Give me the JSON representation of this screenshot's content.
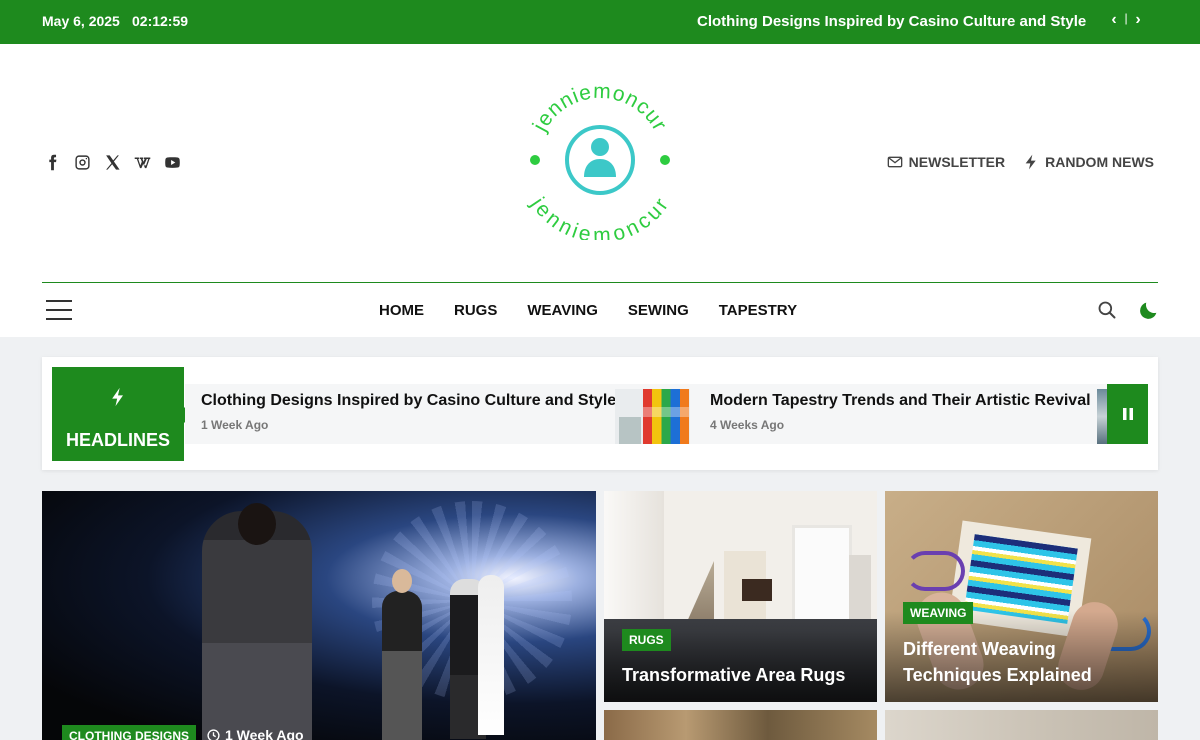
{
  "topbar": {
    "date": "May 6, 2025",
    "time": "02:12:59",
    "ticker": "Clothing Designs Inspired by Casino Culture and Style",
    "prev": "‹",
    "next": "›",
    "sep": "|"
  },
  "header": {
    "logo_text": "jenniemoncur",
    "social": [
      "facebook-icon",
      "instagram-icon",
      "x-icon",
      "wikipedia-icon",
      "youtube-icon"
    ],
    "newsletter": "NEWSLETTER",
    "random_news": "RANDOM NEWS"
  },
  "nav": {
    "items": [
      "HOME",
      "RUGS",
      "WEAVING",
      "SEWING",
      "TAPESTRY"
    ]
  },
  "headlines": {
    "label": "HEADLINES",
    "items": [
      {
        "title": "Clothing Designs Inspired by Casino Culture and Style",
        "meta": "1 Week Ago"
      },
      {
        "title": "Modern Tapestry Trends and Their Artistic Revival",
        "meta": "4 Weeks Ago"
      }
    ]
  },
  "featured": {
    "main": {
      "category": "CLOTHING DESIGNS",
      "meta": "1 Week Ago"
    },
    "card1": {
      "category": "RUGS",
      "title": "Transformative Area Rugs"
    },
    "card2": {
      "category": "WEAVING",
      "title": "Different Weaving Techniques Explained"
    }
  },
  "colors": {
    "accent": "#1e8a1e",
    "logo": "#2ecc40",
    "logo_icon": "#3cc8c8"
  }
}
